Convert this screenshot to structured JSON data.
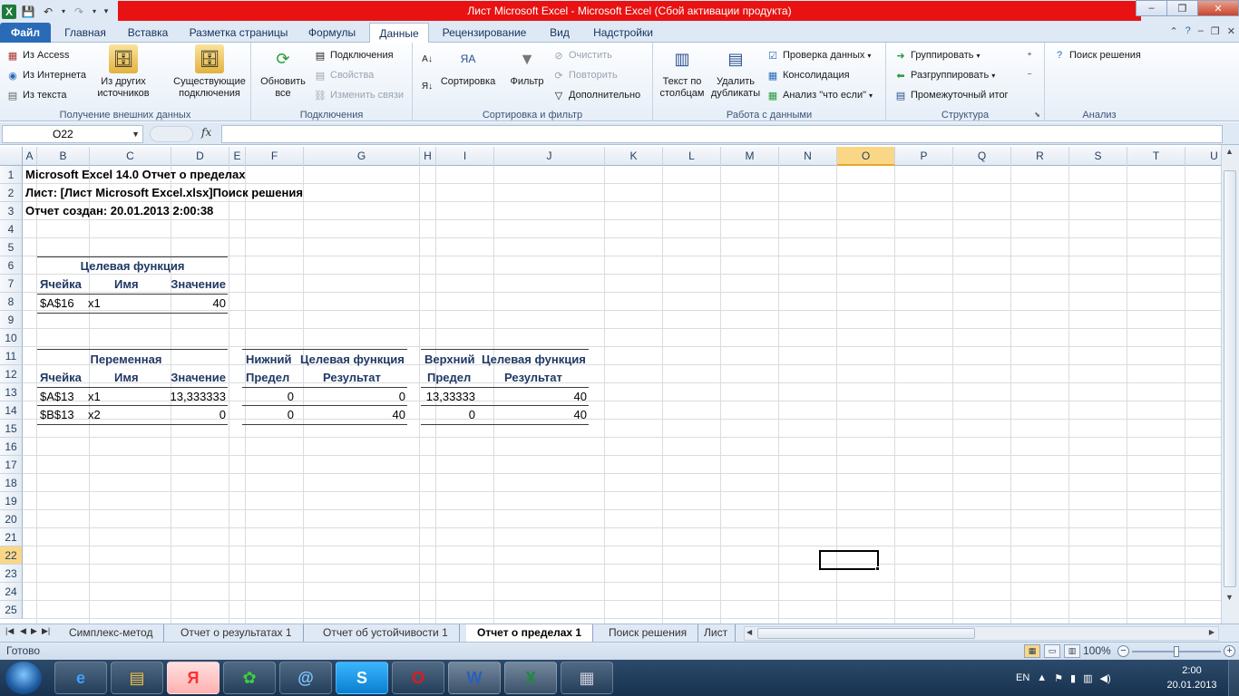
{
  "window": {
    "title": "Лист Microsoft Excel  -  Microsoft Excel (Сбой активации продукта)",
    "min": "–",
    "max": "❐",
    "close": "✕"
  },
  "ribbon_tabs": [
    "Файл",
    "Главная",
    "Вставка",
    "Разметка страницы",
    "Формулы",
    "Данные",
    "Рецензирование",
    "Вид",
    "Надстройки"
  ],
  "ribbon": {
    "get_external": {
      "label": "Получение внешних данных",
      "from_access": "Из Access",
      "from_web": "Из Интернета",
      "from_text": "Из текста",
      "from_other": "Из других источников",
      "existing": "Существующие подключения"
    },
    "connections": {
      "label": "Подключения",
      "refresh_all": "Обновить все",
      "connections": "Подключения",
      "properties": "Свойства",
      "edit_links": "Изменить связи"
    },
    "sort_filter": {
      "label": "Сортировка и фильтр",
      "sort": "Сортировка",
      "filter": "Фильтр",
      "clear": "Очистить",
      "reapply": "Повторить",
      "advanced": "Дополнительно"
    },
    "data_tools": {
      "label": "Работа с данными",
      "text_to_columns": "Текст по столбцам",
      "remove_duplicates": "Удалить дубликаты",
      "data_validation": "Проверка данных",
      "consolidate": "Консолидация",
      "what_if": "Анализ \"что если\""
    },
    "outline": {
      "label": "Структура",
      "group": "Группировать",
      "ungroup": "Разгруппировать",
      "subtotal": "Промежуточный итог"
    },
    "analysis": {
      "label": "Анализ",
      "solver": "Поиск решения"
    }
  },
  "formula_bar": {
    "name_box": "O22",
    "fx": "fx",
    "formula": ""
  },
  "columns": [
    "A",
    "B",
    "C",
    "D",
    "E",
    "F",
    "G",
    "H",
    "I",
    "J",
    "K",
    "L",
    "M",
    "N",
    "O",
    "P",
    "Q",
    "R",
    "S",
    "T",
    "U"
  ],
  "rows": [
    "1",
    "2",
    "3",
    "4",
    "5",
    "6",
    "7",
    "8",
    "9",
    "10",
    "11",
    "12",
    "13",
    "14",
    "15",
    "16",
    "17",
    "18",
    "19",
    "20",
    "21",
    "22",
    "23",
    "24",
    "25"
  ],
  "sheet": {
    "r1": "Microsoft Excel 14.0 Отчет о пределах",
    "r2": "Лист: [Лист Microsoft Excel.xlsx]Поиск решения",
    "r3": "Отчет создан: 20.01.2013 2:00:38",
    "objective": {
      "title": "Целевая функция",
      "col_cell": "Ячейка",
      "col_name": "Имя",
      "col_value": "Значение",
      "row": {
        "cell": "$A$16",
        "name": "x1",
        "value": "40"
      }
    },
    "variables": {
      "title": "Переменная",
      "col_cell": "Ячейка",
      "col_name": "Имя",
      "col_value": "Значение",
      "rows": [
        {
          "cell": "$A$13",
          "name": "x1",
          "value": "13,333333"
        },
        {
          "cell": "$B$13",
          "name": "x2",
          "value": "0"
        }
      ]
    },
    "lower": {
      "h1": "Нижний",
      "h2": "Предел",
      "obj1": "Целевая функция",
      "obj2": "Результат",
      "rows": [
        {
          "limit": "0",
          "result": "0"
        },
        {
          "limit": "0",
          "result": "40"
        }
      ]
    },
    "upper": {
      "h1": "Верхний",
      "h2": "Предел",
      "obj1": "Целевая функция",
      "obj2": "Результат",
      "rows": [
        {
          "limit": "13,33333",
          "result": "40"
        },
        {
          "limit": "0",
          "result": "40"
        }
      ]
    }
  },
  "sheet_tabs": [
    "Симплекс-метод",
    "Отчет о результатах 1",
    "Отчет об устойчивости 1",
    "Отчет о пределах 1",
    "Поиск решения",
    "Лист"
  ],
  "active_sheet": "Отчет о пределах 1",
  "status": {
    "ready": "Готово",
    "zoom": "100%",
    "zoom_level": 1.0
  },
  "taskbar": {
    "apps": [
      "internet-explorer-icon",
      "explorer-icon",
      "yandex-icon",
      "icq-icon",
      "mail-icon",
      "skype-icon",
      "opera-icon",
      "word-icon",
      "excel-icon",
      "calculator-icon"
    ],
    "lang": "EN",
    "time": "2:00",
    "date": "20.01.2013"
  },
  "colors": {
    "title_red": "#e81212",
    "file_tab": "#2a6bb8",
    "header_text": "#1f3864",
    "selected_header": "#f9d787"
  }
}
